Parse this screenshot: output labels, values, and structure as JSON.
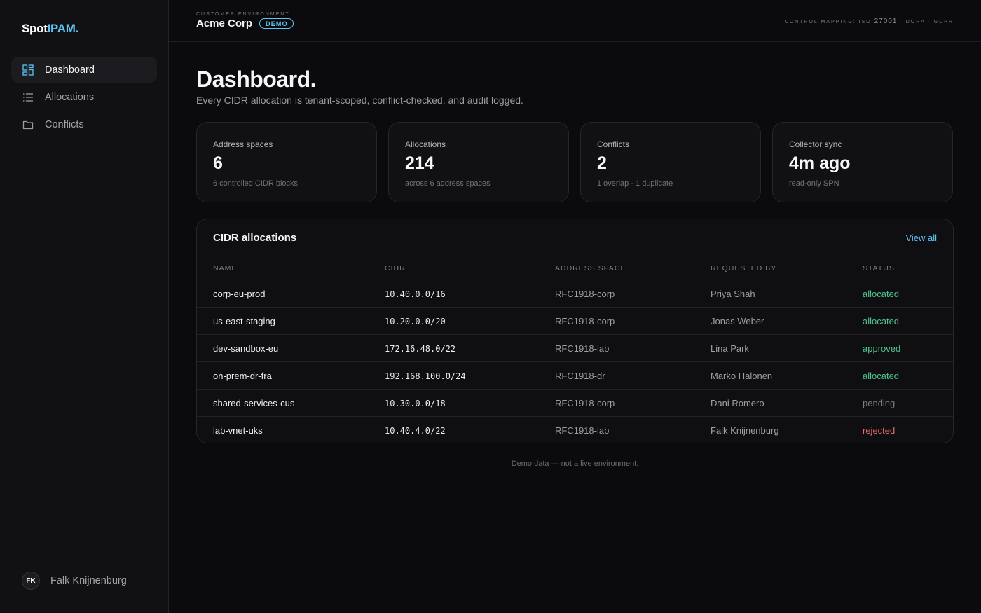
{
  "brand": {
    "part1": "Spot",
    "part2": "IPAM."
  },
  "nav": {
    "items": [
      {
        "label": "Dashboard",
        "icon": "dashboard-grid-icon",
        "active": true
      },
      {
        "label": "Allocations",
        "icon": "list-icon",
        "active": false
      },
      {
        "label": "Conflicts",
        "icon": "folder-icon",
        "active": false
      }
    ]
  },
  "user": {
    "initials": "FK",
    "name": "Falk Knijnenburg"
  },
  "topbar": {
    "env_label": "CUSTOMER ENVIRONMENT",
    "env_name": "Acme Corp",
    "badge": "DEMO",
    "control_prefix": "CONTROL MAPPING: ISO",
    "control_num": "27001",
    "control_suffix": "· DORA · GDPR"
  },
  "page": {
    "title": "Dashboard.",
    "subtitle": "Every CIDR allocation is tenant-scoped, conflict-checked, and audit logged."
  },
  "stats": [
    {
      "label": "Address spaces",
      "value": "6",
      "hint": "6 controlled CIDR blocks"
    },
    {
      "label": "Allocations",
      "value": "214",
      "hint": "across 6 address spaces"
    },
    {
      "label": "Conflicts",
      "value": "2",
      "hint": "1 overlap · 1 duplicate"
    },
    {
      "label": "Collector sync",
      "value": "4m ago",
      "hint": "read-only SPN"
    }
  ],
  "table": {
    "title": "CIDR allocations",
    "view_all": "View all",
    "columns": [
      "NAME",
      "CIDR",
      "ADDRESS SPACE",
      "REQUESTED BY",
      "STATUS"
    ],
    "rows": [
      {
        "name": "corp-eu-prod",
        "cidr": "10.40.0.0/16",
        "space": "RFC1918-corp",
        "requested_by": "Priya Shah",
        "status": "allocated"
      },
      {
        "name": "us-east-staging",
        "cidr": "10.20.0.0/20",
        "space": "RFC1918-corp",
        "requested_by": "Jonas Weber",
        "status": "allocated"
      },
      {
        "name": "dev-sandbox-eu",
        "cidr": "172.16.48.0/22",
        "space": "RFC1918-lab",
        "requested_by": "Lina Park",
        "status": "approved"
      },
      {
        "name": "on-prem-dr-fra",
        "cidr": "192.168.100.0/24",
        "space": "RFC1918-dr",
        "requested_by": "Marko Halonen",
        "status": "allocated"
      },
      {
        "name": "shared-services-cus",
        "cidr": "10.30.0.0/18",
        "space": "RFC1918-corp",
        "requested_by": "Dani Romero",
        "status": "pending"
      },
      {
        "name": "lab-vnet-uks",
        "cidr": "10.40.4.0/22",
        "space": "RFC1918-lab",
        "requested_by": "Falk Knijnenburg",
        "status": "rejected"
      }
    ]
  },
  "status_colors": {
    "allocated": "#4fc48c",
    "approved": "#4fc48c",
    "pending": "#7c7c84",
    "rejected": "#ef6b6b"
  },
  "accent_color": "#5ec4f2",
  "footer_note": "Demo data — not a live environment."
}
